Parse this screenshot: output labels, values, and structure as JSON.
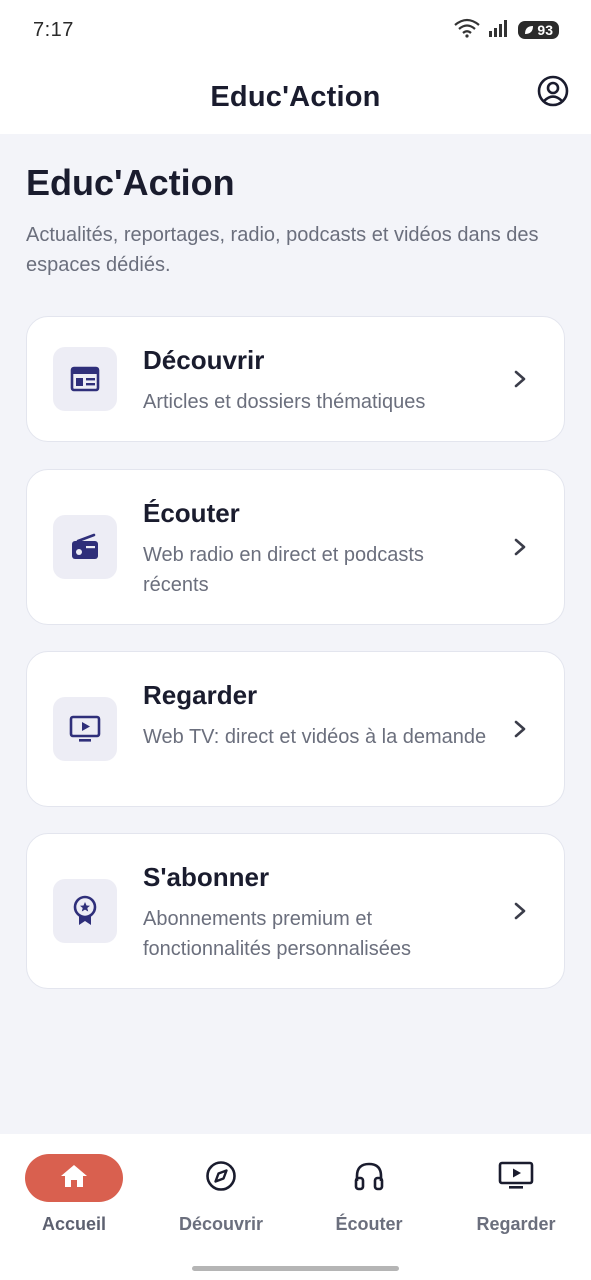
{
  "status_bar": {
    "time": "7:17",
    "battery": "93"
  },
  "header": {
    "title": "Educ'Action"
  },
  "page": {
    "title": "Educ'Action",
    "subtitle": "Actualités, reportages, radio, podcasts et vidéos dans des espaces dédiés."
  },
  "cards": [
    {
      "title": "Découvrir",
      "description": "Articles et dossiers thématiques",
      "icon": "newspaper-icon"
    },
    {
      "title": "Écouter",
      "description": "Web radio en direct et podcasts récents",
      "icon": "radio-icon"
    },
    {
      "title": "Regarder",
      "description": "Web TV: direct et vidéos à la demande",
      "icon": "tv-play-icon"
    },
    {
      "title": "S'abonner",
      "description": "Abonnements premium et fonctionnalités personnalisées",
      "icon": "award-badge-icon"
    }
  ],
  "bottom_nav": {
    "active": "Accueil",
    "items": [
      {
        "label": "Accueil",
        "icon": "home-icon"
      },
      {
        "label": "Découvrir",
        "icon": "compass-icon"
      },
      {
        "label": "Écouter",
        "icon": "headphones-icon"
      },
      {
        "label": "Regarder",
        "icon": "tv-play-icon"
      }
    ]
  },
  "colors": {
    "accent": "#d9604f",
    "icon_primary": "#2f2f7a",
    "icon_tile_bg": "#ededf5",
    "background": "#f3f4f9",
    "text_primary": "#1a1c2e",
    "text_secondary": "#6b6f7d"
  }
}
